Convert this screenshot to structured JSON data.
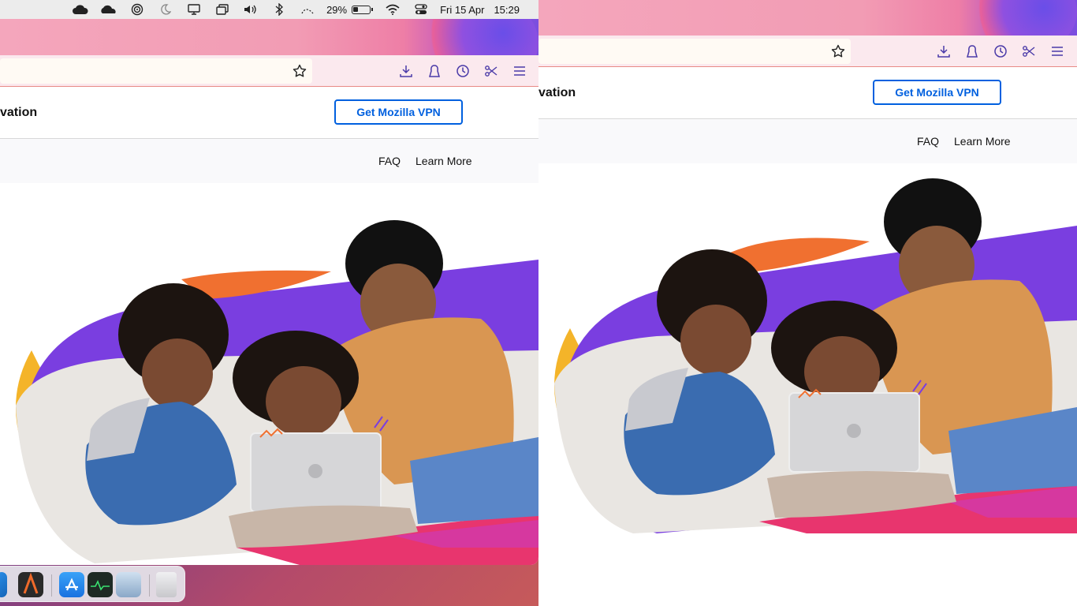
{
  "menubar": {
    "battery_percent": "29%",
    "date": "Fri 15 Apr",
    "time": "15:29",
    "icons": [
      "cloud-icon",
      "cloudflare-icon",
      "airdrop-icon",
      "moon-icon",
      "display-icon",
      "window-icon",
      "volume-icon",
      "bluetooth-icon",
      "activity-icon",
      "battery-icon",
      "wifi-icon",
      "control-center-icon"
    ]
  },
  "browser": {
    "toolbar_icons": [
      "download-icon",
      "account-icon",
      "history-icon",
      "screenshot-icon",
      "menu-icon"
    ],
    "bookmark_icon": "star-icon"
  },
  "site": {
    "brand_left": "vation",
    "brand_right": "vation",
    "cta": "Get Mozilla VPN",
    "nav": {
      "faq": "FAQ",
      "learn_more": "Learn More"
    }
  },
  "dock": {
    "items": [
      "vscode-icon",
      "alacritty-icon",
      "app-store-icon",
      "activity-monitor-icon",
      "preview-icon",
      "trash-icon"
    ]
  },
  "colors": {
    "accent": "#0060df",
    "orange": "#f07030",
    "purple": "#7a3ee0",
    "yellow": "#f4b429",
    "pink": "#e8356e"
  }
}
